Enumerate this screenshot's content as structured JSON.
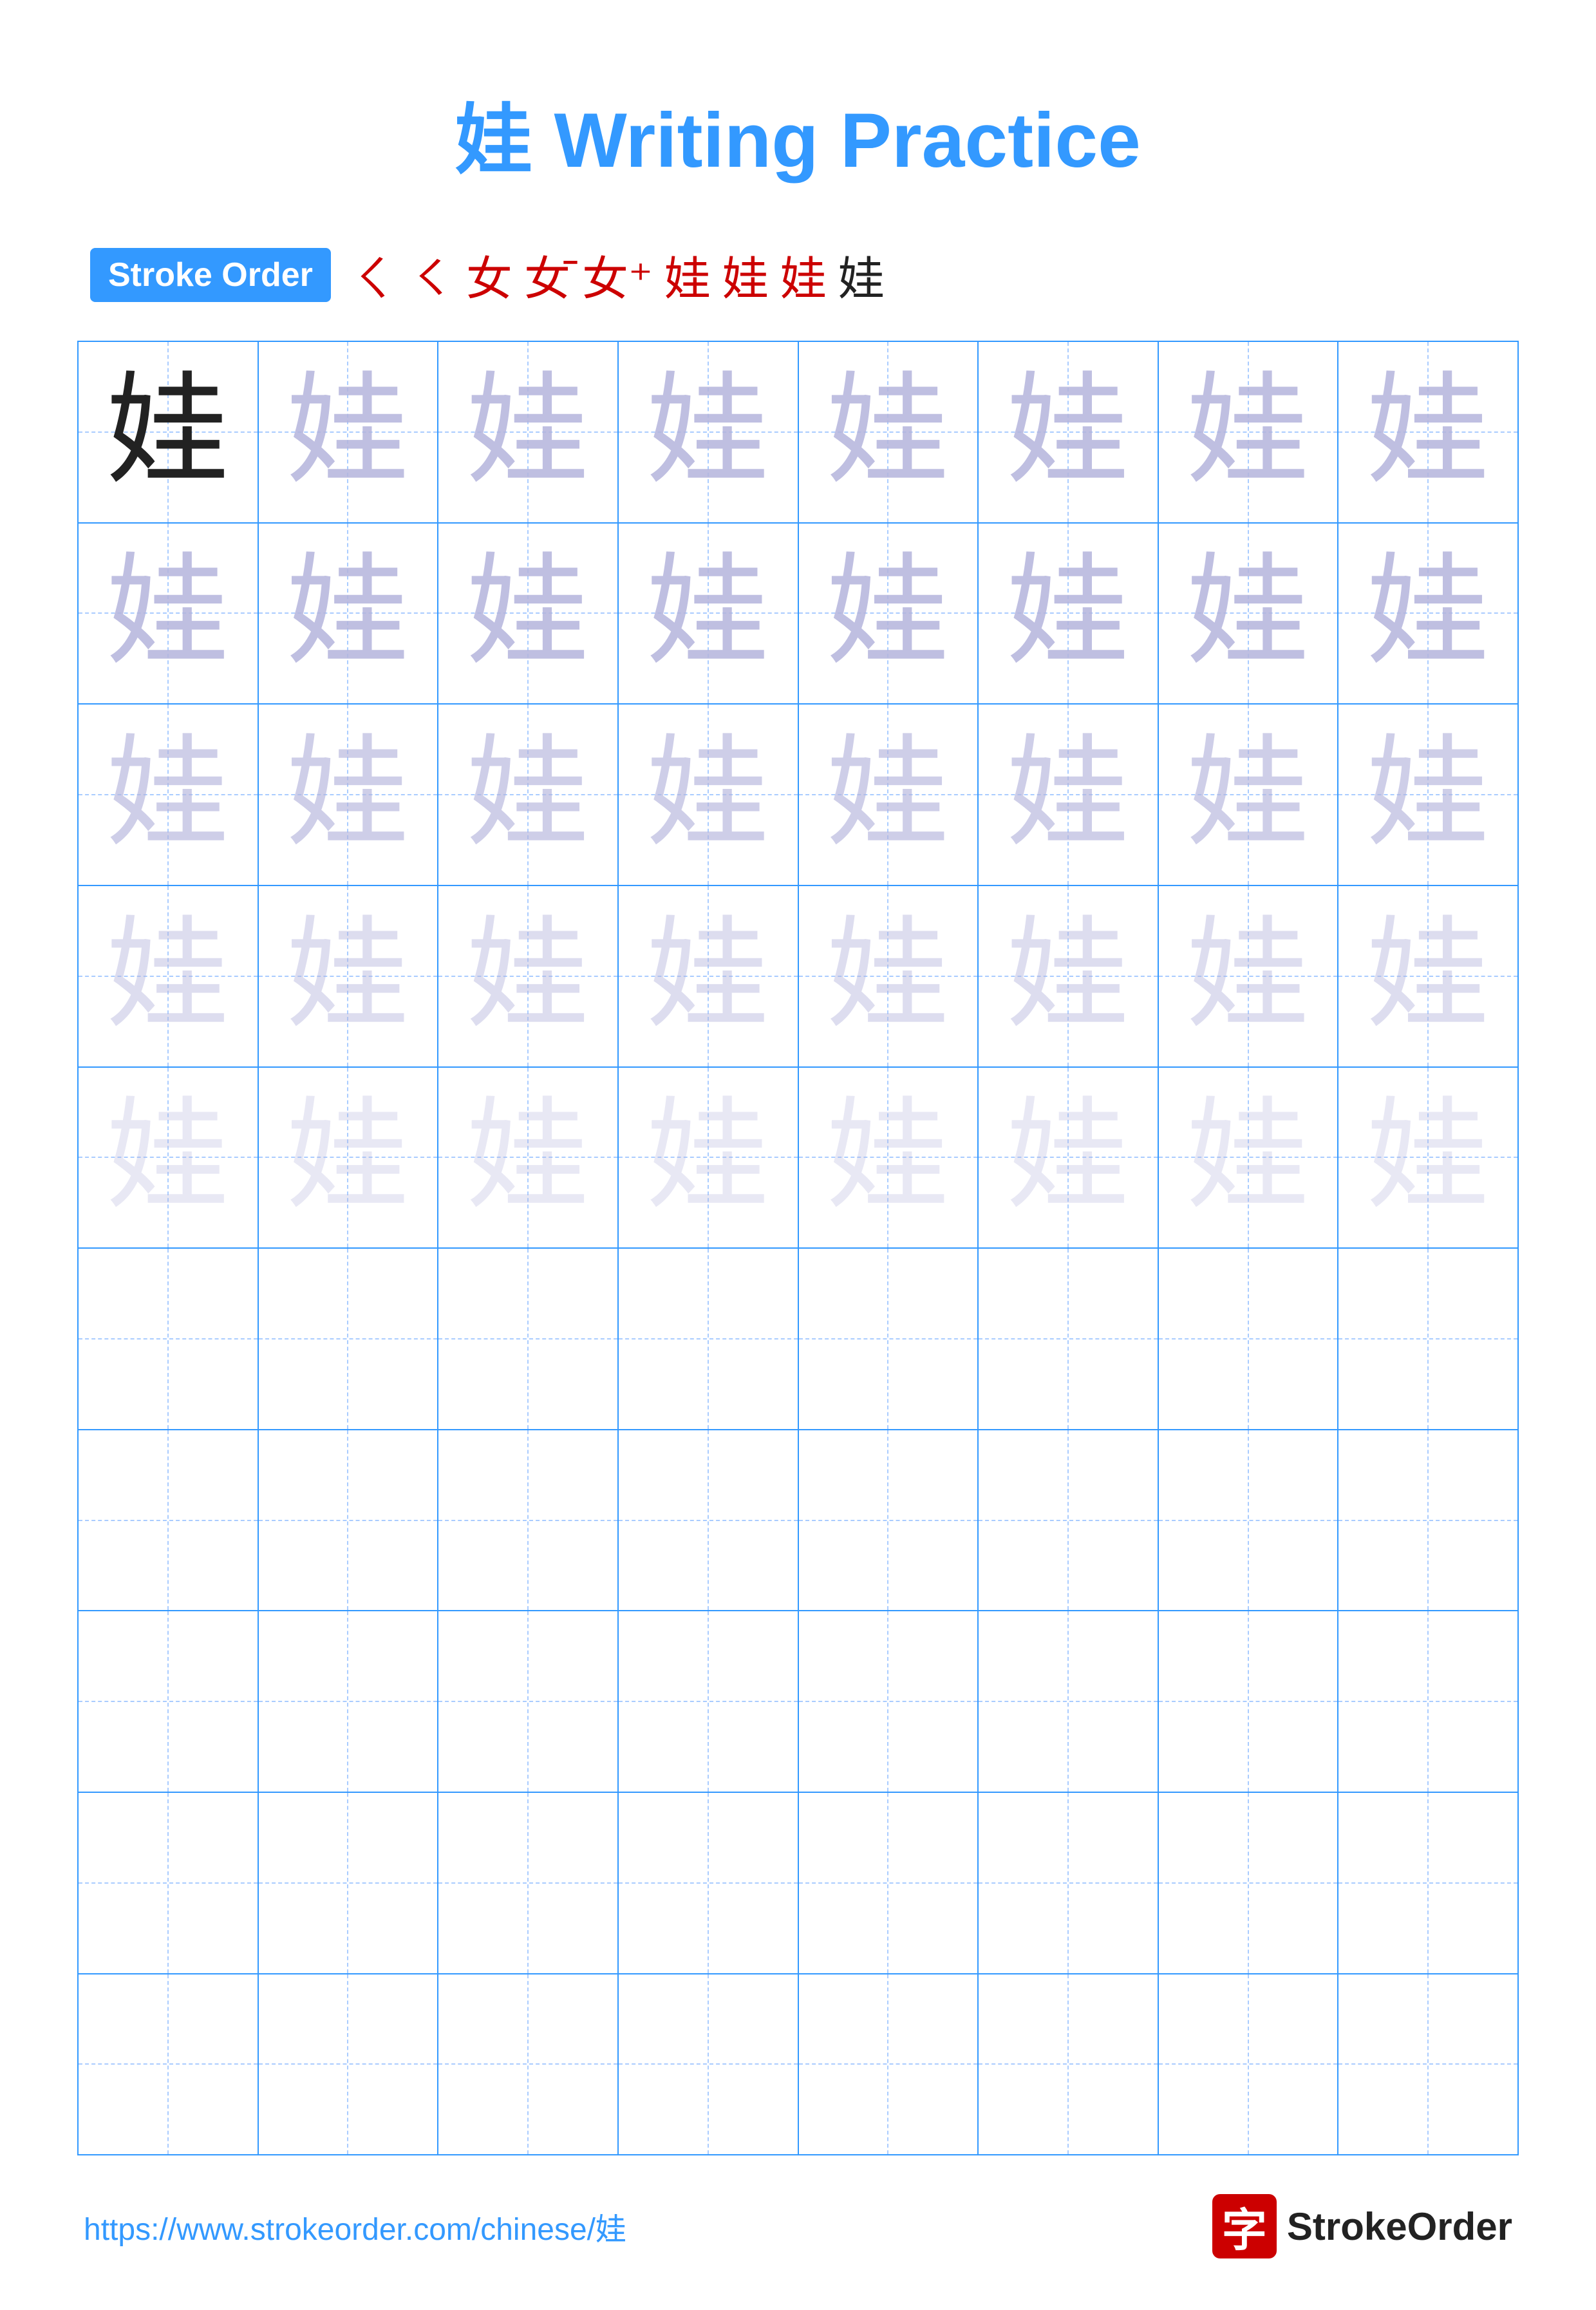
{
  "title": "娃 Writing Practice",
  "stroke_order": {
    "label": "Stroke Order",
    "sequence": [
      "𠃌",
      "㇛",
      "女",
      "女˜",
      "女+",
      "娃",
      "娃",
      "娃",
      "娃"
    ]
  },
  "character": "娃",
  "grid": {
    "rows": 10,
    "cols": 8,
    "char_rows": [
      {
        "type": "dark",
        "count": 1,
        "rest_type": "light1"
      },
      {
        "type": "light1",
        "count": 8
      },
      {
        "type": "light2",
        "count": 8
      },
      {
        "type": "light3",
        "count": 8
      },
      {
        "type": "light4",
        "count": 8
      },
      {
        "type": "empty",
        "count": 8
      },
      {
        "type": "empty",
        "count": 8
      },
      {
        "type": "empty",
        "count": 8
      },
      {
        "type": "empty",
        "count": 8
      },
      {
        "type": "empty",
        "count": 8
      }
    ]
  },
  "footer": {
    "url": "https://www.strokeorder.com/chinese/娃",
    "logo_char": "字",
    "logo_text": "StrokeOrder"
  }
}
